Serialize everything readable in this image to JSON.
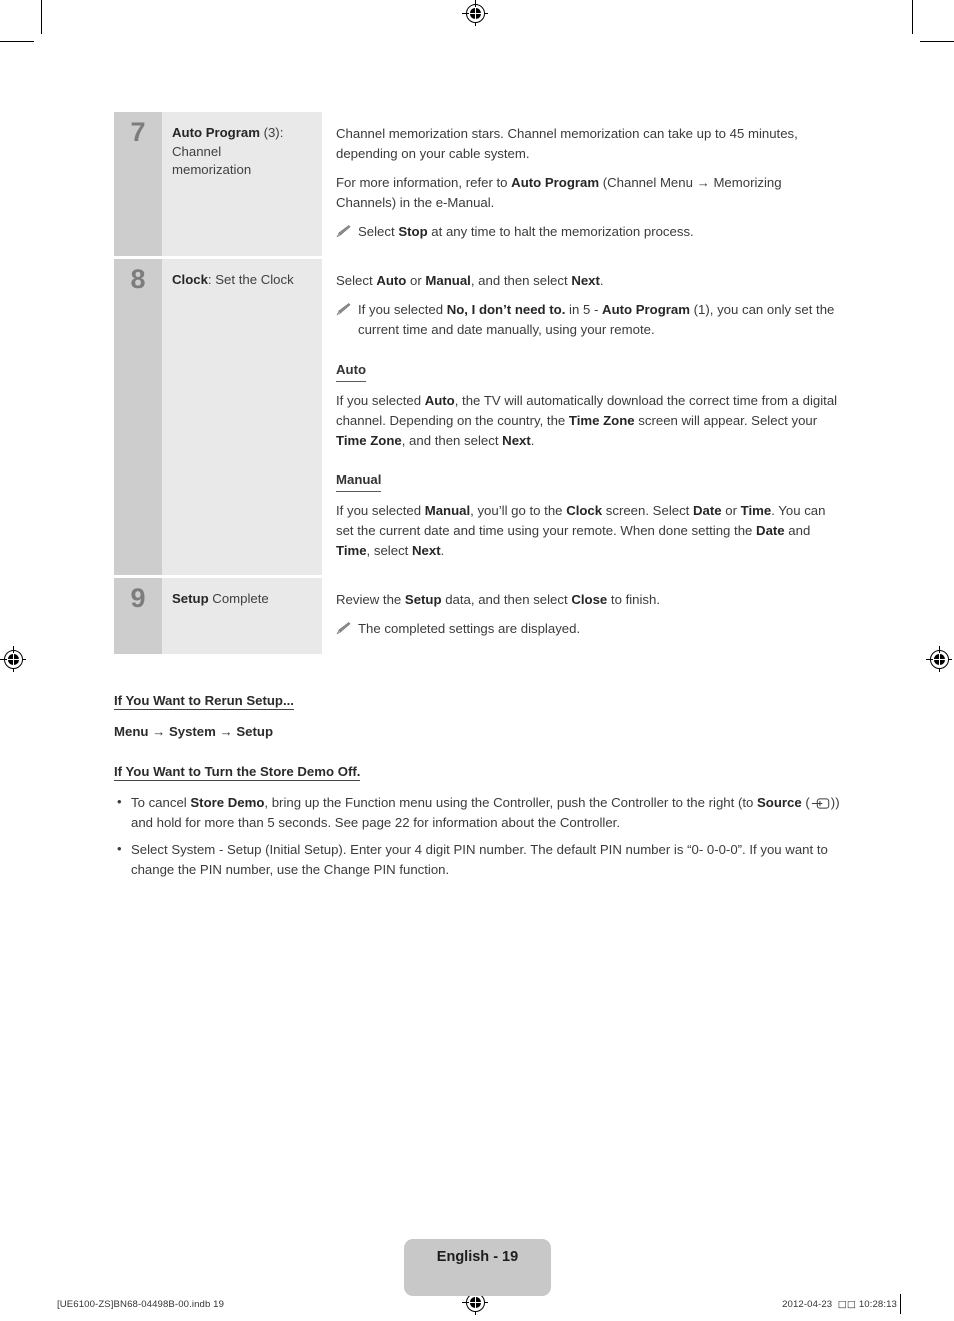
{
  "document": {
    "page_label": "English - 19",
    "footer_left": "[UE6100-ZS]BN68-04498B-00.indb   19",
    "footer_date": "2012-04-23",
    "footer_time_prefix": "□□",
    "footer_time": "10:28:13"
  },
  "steps": [
    {
      "number": "7",
      "label_bold": "Auto Program",
      "label_rest": " (3): Channel memorization",
      "paragraphs": [
        "Channel memorization stars. Channel memorization can take up to 45 minutes, depending on your cable system.",
        "For more information, refer to Auto Program (Channel Menu → Memorizing Channels) in the e-Manual."
      ],
      "note": "Select Stop at any time to halt the memorization process."
    },
    {
      "number": "8",
      "label_bold": "Clock",
      "label_rest": ": Set the Clock",
      "lead": "Select Auto or Manual, and then select Next.",
      "note": "If you selected No, I don’t need to. in 5 - Auto Program (1), you can only set the current time and date manually, using your remote.",
      "sub_sections": [
        {
          "heading": "Auto",
          "body": "If you selected Auto, the TV will automatically download the correct time from a digital channel. Depending on the country, the Time Zone screen will appear. Select your Time Zone, and then select Next."
        },
        {
          "heading": "Manual",
          "body": "If you selected Manual, you’ll go to the Clock screen. Select Date or Time. You can set the current date and time using your remote. When done setting the Date and Time, select Next."
        }
      ]
    },
    {
      "number": "9",
      "label_bold": "Setup",
      "label_rest": " Complete",
      "lead": "Review the Setup data, and then select Close to finish.",
      "note": "The completed settings are displayed."
    }
  ],
  "rerun": {
    "heading": "If You Want to Rerun Setup...",
    "path": "Menu → System → Setup"
  },
  "store_demo": {
    "heading": "If You Want to Turn the Store Demo Off.",
    "bullets": [
      {
        "part1": "To cancel ",
        "bold1": "Store Demo",
        "part2": ", bring up the Function menu using the Controller, push the Controller to the right (to ",
        "bold2": "Source",
        "part3": " (",
        "icon": "source-input-icon",
        "part4": ")) and hold for more than 5 seconds. See page 22 for information about the Controller."
      },
      {
        "text": "Select System - Setup (Initial Setup). Enter your 4 digit PIN number. The default PIN number is “0- 0-0-0”. If you want to change the PIN number, use the Change PIN function."
      }
    ]
  },
  "colors": {
    "number_cell": "#cdcdcd",
    "label_cell": "#e9e9e9",
    "badge": "#c8c8c8",
    "body_text": "#3b3b3b"
  }
}
